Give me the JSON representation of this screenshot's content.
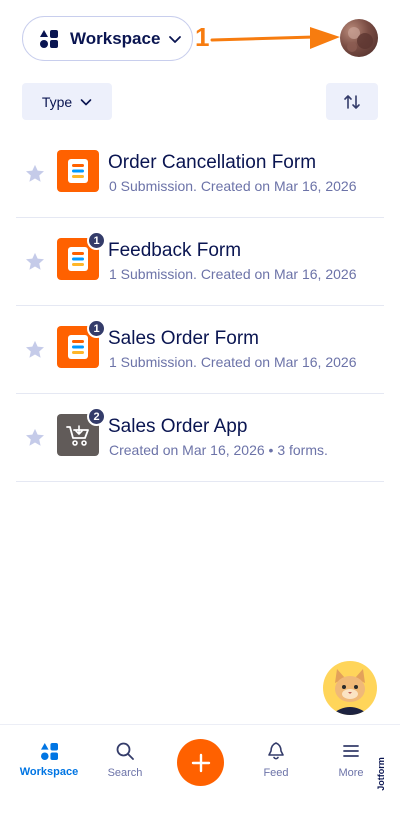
{
  "header": {
    "workspace_label": "Workspace",
    "annotation_number": "1"
  },
  "toolbar": {
    "type_label": "Type"
  },
  "forms": [
    {
      "title": "Order Cancellation Form",
      "meta": "0 Submission. Created on Mar 16, 2026",
      "badge": "",
      "kind": "form"
    },
    {
      "title": "Feedback Form",
      "meta": "1 Submission. Created on Mar 16, 2026",
      "badge": "1",
      "kind": "form"
    },
    {
      "title": "Sales Order Form",
      "meta": "1 Submission. Created on Mar 16, 2026",
      "badge": "1",
      "kind": "form"
    },
    {
      "title": "Sales Order App",
      "meta": "Created on Mar 16, 2026 • 3 forms.",
      "badge": "2",
      "kind": "app"
    }
  ],
  "bottom_nav": {
    "workspace": "Workspace",
    "search": "Search",
    "feed": "Feed",
    "more": "More"
  },
  "brand": {
    "name": "Jotform"
  },
  "colors": {
    "accent": "#ff6100",
    "navy": "#0a1551",
    "active_blue": "#0075e3",
    "annotation": "#f77c0f",
    "badge": "#343c6a",
    "app_icon": "#615b59"
  }
}
